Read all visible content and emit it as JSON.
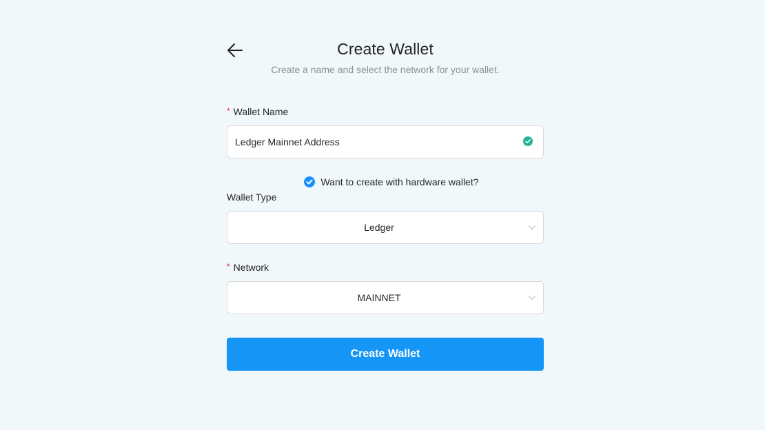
{
  "header": {
    "title": "Create Wallet",
    "subtitle": "Create a name and select the network for your wallet."
  },
  "wallet_name": {
    "required_mark": "*",
    "label": "Wallet Name",
    "value": "Ledger Mainnet Address"
  },
  "hardware": {
    "label": "Want to create with hardware wallet?",
    "checked": true
  },
  "wallet_type": {
    "label": "Wallet Type",
    "selected": "Ledger"
  },
  "network": {
    "required_mark": "*",
    "label": "Network",
    "selected": "MAINNET"
  },
  "submit": {
    "label": "Create Wallet"
  },
  "colors": {
    "background": "#f1f8fc",
    "primary": "#1595f6",
    "success": "#21b59a",
    "required": "#f5222d"
  },
  "icons": {
    "back": "arrow-left-icon",
    "valid": "check-circle-icon",
    "dropdown": "chevron-down-icon"
  }
}
